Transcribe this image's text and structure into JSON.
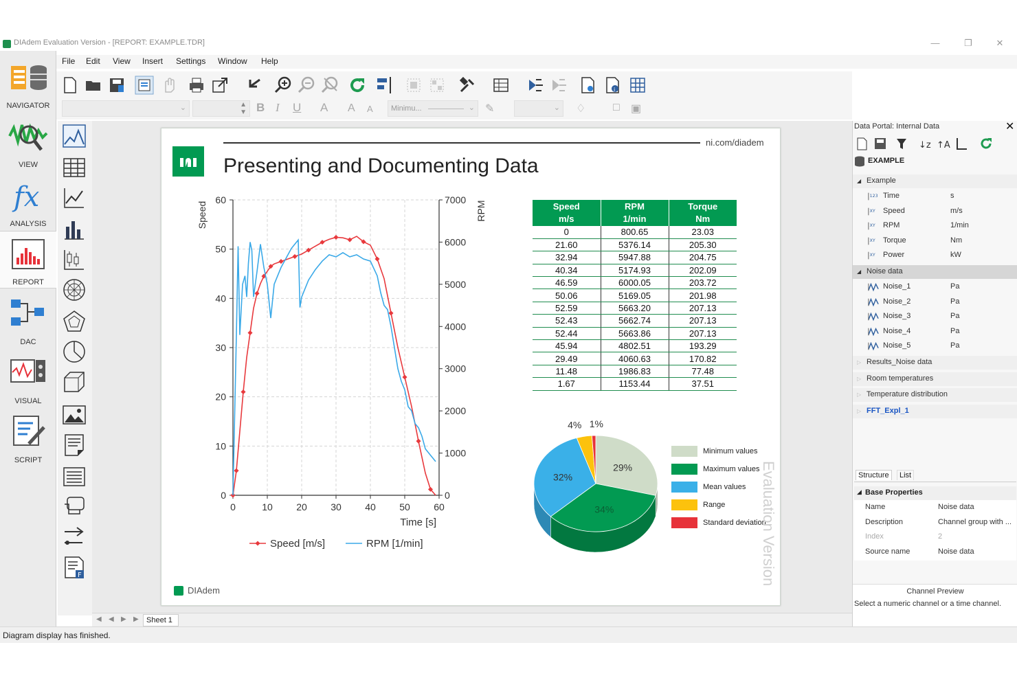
{
  "window": {
    "title": "DIAdem Evaluation Version - [REPORT:   EXAMPLE.TDR]"
  },
  "nav": [
    {
      "label": "NAVIGATOR",
      "icon": "navigator-icon"
    },
    {
      "label": "VIEW",
      "icon": "view-icon"
    },
    {
      "label": "ANALYSIS",
      "icon": "analysis-icon"
    },
    {
      "label": "REPORT",
      "icon": "report-icon",
      "active": true
    },
    {
      "label": "DAC",
      "icon": "dac-icon"
    },
    {
      "label": "VISUAL",
      "icon": "visual-icon"
    },
    {
      "label": "SCRIPT",
      "icon": "script-icon"
    }
  ],
  "menu": [
    "File",
    "Edit",
    "View",
    "Insert",
    "Settings",
    "Window",
    "Help"
  ],
  "toolbar2": {
    "line_style": "Minimu..."
  },
  "report": {
    "url": "ni.com/diadem",
    "title": "Presenting and Documenting Data",
    "footer_logo": "DIAdem",
    "watermark": "Evaluation Version"
  },
  "chart_data": [
    {
      "type": "line",
      "xlabel": "Time [s]",
      "ylabel": "Speed",
      "y2label": "RPM",
      "xlim": [
        0,
        60
      ],
      "ylim": [
        0,
        60
      ],
      "y2lim": [
        0,
        7000
      ],
      "xticks": [
        0,
        10,
        20,
        30,
        40,
        50,
        60
      ],
      "yticks": [
        0,
        10,
        20,
        30,
        40,
        50,
        60
      ],
      "y2ticks": [
        0,
        1000,
        2000,
        3000,
        4000,
        5000,
        6000,
        7000
      ],
      "grid": true,
      "legend": "bottom",
      "series": [
        {
          "name": "Speed [m/s]",
          "axis": "left",
          "color": "#e8393d",
          "markers": true,
          "x": [
            0,
            1,
            2,
            3,
            4,
            5,
            6,
            7,
            8,
            9,
            10,
            11,
            12,
            14,
            16,
            18,
            20,
            22,
            24,
            26,
            28,
            30,
            32,
            34,
            36,
            38,
            40,
            42,
            44,
            46,
            48,
            50,
            52,
            54,
            56,
            57.5,
            59
          ],
          "y": [
            0,
            5,
            13,
            21,
            28,
            33,
            38,
            41,
            43,
            44.5,
            45.5,
            46.5,
            47,
            47.5,
            48,
            48.5,
            49,
            49.8,
            50.6,
            51.4,
            52,
            52.4,
            52.3,
            51.9,
            52.6,
            51.5,
            50.8,
            48,
            44,
            37,
            30,
            24,
            18,
            11,
            4.5,
            1.2,
            0
          ]
        },
        {
          "name": "RPM [1/min]",
          "axis": "right",
          "color": "#3aa9e8",
          "markers": false,
          "x": [
            0,
            1,
            1.5,
            2,
            2.8,
            3.5,
            4,
            4.5,
            5,
            5.5,
            6,
            7,
            8,
            9,
            10,
            11,
            12,
            13,
            14,
            15,
            16,
            17,
            18,
            19,
            19.5,
            20,
            22,
            24,
            26,
            28,
            30,
            32,
            34,
            36,
            38,
            40,
            42,
            43,
            44,
            45,
            46,
            47,
            48,
            49,
            50,
            51,
            52,
            53,
            54,
            55,
            56,
            57,
            58,
            59
          ],
          "y": [
            0,
            3800,
            5900,
            3800,
            5000,
            5200,
            4700,
            5500,
            6000,
            5800,
            4700,
            5300,
            5950,
            5400,
            5000,
            4200,
            5000,
            5200,
            5400,
            5550,
            5700,
            5850,
            5950,
            6050,
            4450,
            4700,
            5100,
            5350,
            5550,
            5700,
            5650,
            5750,
            5650,
            5700,
            5600,
            5550,
            5200,
            4800,
            4500,
            4400,
            4000,
            3500,
            3000,
            2700,
            2500,
            2100,
            2000,
            1700,
            1600,
            1400,
            1100,
            1000,
            900,
            800
          ]
        }
      ]
    },
    {
      "type": "table",
      "columns": [
        "Speed\nm/s",
        "RPM\n1/min",
        "Torque\nNm"
      ],
      "headers": [
        [
          "Speed",
          "m/s"
        ],
        [
          "RPM",
          "1/min"
        ],
        [
          "Torque",
          "Nm"
        ]
      ],
      "rows": [
        [
          "0",
          "800.65",
          "23.03"
        ],
        [
          "21.60",
          "5376.14",
          "205.30"
        ],
        [
          "32.94",
          "5947.88",
          "204.75"
        ],
        [
          "40.34",
          "5174.93",
          "202.09"
        ],
        [
          "46.59",
          "6000.05",
          "203.72"
        ],
        [
          "50.06",
          "5169.05",
          "201.98"
        ],
        [
          "52.59",
          "5663.20",
          "207.13"
        ],
        [
          "52.43",
          "5662.74",
          "207.13"
        ],
        [
          "52.44",
          "5663.86",
          "207.13"
        ],
        [
          "45.94",
          "4802.51",
          "193.29"
        ],
        [
          "29.49",
          "4060.63",
          "170.82"
        ],
        [
          "11.48",
          "1986.83",
          "77.48"
        ],
        [
          "1.67",
          "1153.44",
          "37.51"
        ]
      ]
    },
    {
      "type": "pie",
      "legend": "right",
      "categories": [
        "Minimum values",
        "Maximum values",
        "Mean values",
        "Range",
        "Standard deviation"
      ],
      "values": [
        29,
        34,
        32,
        4,
        1
      ],
      "labels": [
        "29%",
        "34%",
        "32%",
        "4%",
        "1%"
      ],
      "colors": [
        "#cfdcc8",
        "#029a52",
        "#3ab0e8",
        "#fcc20d",
        "#e7323a"
      ]
    }
  ],
  "palette": [
    "2d-axis-system-icon",
    "table-icon",
    "line-chart-icon",
    "bar-chart-icon",
    "box-plot-icon",
    "polar-plot-icon",
    "radar-plot-icon",
    "pie-chart-icon",
    "3d-axis-icon",
    "picture-icon",
    "text-icon",
    "list-icon",
    "comment-icon",
    "arrows-icon",
    "script-file-icon"
  ],
  "dataportal": {
    "title": "Data Portal: Internal Data",
    "root": "EXAMPLE",
    "groups": [
      {
        "name": "Example",
        "expanded": true,
        "channels": [
          {
            "name": "Time",
            "unit": "s",
            "type": "123"
          },
          {
            "name": "Speed",
            "unit": "m/s",
            "type": "XY"
          },
          {
            "name": "RPM",
            "unit": "1/min",
            "type": "XY"
          },
          {
            "name": "Torque",
            "unit": "Nm",
            "type": "XY"
          },
          {
            "name": "Power",
            "unit": "kW",
            "type": "XY"
          }
        ]
      },
      {
        "name": "Noise data",
        "expanded": true,
        "selected": true,
        "channels": [
          {
            "name": "Noise_1",
            "unit": "Pa",
            "type": "wave"
          },
          {
            "name": "Noise_2",
            "unit": "Pa",
            "type": "wave"
          },
          {
            "name": "Noise_3",
            "unit": "Pa",
            "type": "wave"
          },
          {
            "name": "Noise_4",
            "unit": "Pa",
            "type": "wave"
          },
          {
            "name": "Noise_5",
            "unit": "Pa",
            "type": "wave"
          }
        ]
      },
      {
        "name": "Results_Noise data",
        "expanded": false,
        "channels": []
      },
      {
        "name": "Room temperatures",
        "expanded": false,
        "channels": []
      },
      {
        "name": "Temperature distribution",
        "expanded": false,
        "channels": []
      },
      {
        "name": "FFT_Expl_1",
        "expanded": false,
        "channels": [],
        "highlight": true
      }
    ],
    "tabs": [
      "Structure",
      "List"
    ],
    "properties_title": "Base Properties",
    "properties": [
      {
        "key": "Name",
        "value": "Noise data"
      },
      {
        "key": "Description",
        "value": "Channel group with ..."
      },
      {
        "key": "Index",
        "value": "2"
      },
      {
        "key": "Source name",
        "value": "Noise data"
      }
    ],
    "preview_title": "Channel Preview",
    "preview_text": "Select a numeric channel or a time channel."
  },
  "sheet_tab": "Sheet 1",
  "status": "Diagram display has finished."
}
